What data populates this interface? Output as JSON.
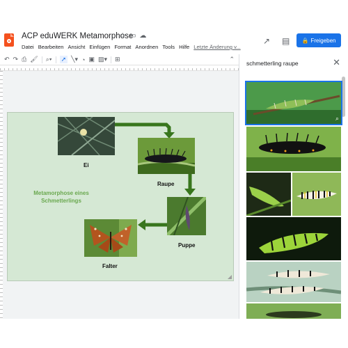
{
  "app": {
    "title": "ACP eduWERK Metamorphose",
    "menu": [
      "Datei",
      "Bearbeiten",
      "Ansicht",
      "Einfügen",
      "Format",
      "Anordnen",
      "Tools",
      "Hilfe"
    ],
    "last_change": "Letzte Änderung v...",
    "share_label": "Freigeben"
  },
  "toolbar": {
    "icons": [
      "undo-icon",
      "redo-icon",
      "print-icon",
      "paint-format-icon",
      "zoom-icon",
      "select-icon",
      "line-icon",
      "shape-icon",
      "textbox-icon",
      "image-icon",
      "comment-icon",
      "collapse-icon"
    ]
  },
  "slide": {
    "title": "Metamorphose eines Schmetterlings",
    "labels": {
      "egg": "Ei",
      "caterpillar": "Raupe",
      "pupa": "Puppe",
      "butterfly": "Falter"
    }
  },
  "panel": {
    "search_query": "schmetterling raupe"
  },
  "colors": {
    "accent": "#1a73e8",
    "slide_bg": "#d5e8d4",
    "arrow": "#38761d",
    "title_green": "#6aa84f"
  }
}
